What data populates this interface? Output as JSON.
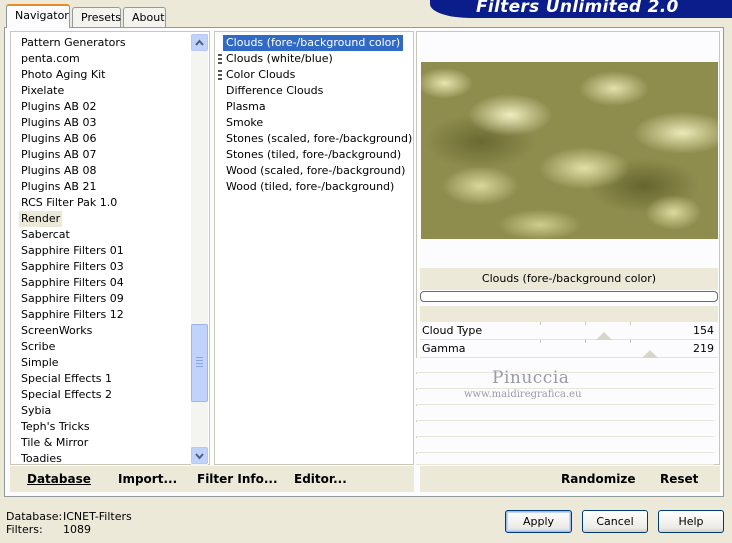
{
  "tabs": [
    {
      "label": "Navigator",
      "active": true
    },
    {
      "label": "Presets",
      "active": false
    },
    {
      "label": "About",
      "active": false
    }
  ],
  "banner_title": "Filters Unlimited 2.0",
  "categories": [
    "Pattern Generators",
    "penta.com",
    "Photo Aging Kit",
    "Pixelate",
    "Plugins AB 02",
    "Plugins AB 03",
    "Plugins AB 06",
    "Plugins AB 07",
    "Plugins AB 08",
    "Plugins AB 21",
    "RCS Filter Pak 1.0",
    "Render",
    "Sabercat",
    "Sapphire Filters 01",
    "Sapphire Filters 03",
    "Sapphire Filters 04",
    "Sapphire Filters 09",
    "Sapphire Filters 12",
    "ScreenWorks",
    "Scribe",
    "Simple",
    "Special Effects 1",
    "Special Effects 2",
    "Sybia",
    "Teph's Tricks",
    "Tile & Mirror",
    "Toadies"
  ],
  "selected_category": "Render",
  "filters": [
    "Clouds (fore-/background color)",
    "Clouds (white/blue)",
    "Color Clouds",
    "Difference Clouds",
    "Plasma",
    "Smoke",
    "Stones (scaled, fore-/background)",
    "Stones (tiled, fore-/background)",
    "Wood (scaled, fore-/background)",
    "Wood (tiled, fore-/background)"
  ],
  "selected_filter": "Clouds (fore-/background color)",
  "left_buttons": {
    "database": "Database",
    "import": "Import...",
    "filter_info": "Filter Info...",
    "editor": "Editor..."
  },
  "preview_caption": "Clouds (fore-/background color)",
  "params": [
    {
      "label": "Cloud Type",
      "value": "154",
      "fraction": 0.604
    },
    {
      "label": "Gamma",
      "value": "219",
      "fraction": 0.859
    }
  ],
  "watermark": {
    "name": "Pinuccia",
    "url": "www.maidiregrafica.eu"
  },
  "right_buttons": {
    "randomize": "Randomize",
    "reset": "Reset"
  },
  "status": {
    "database_label": "Database:",
    "database_value": "ICNET-Filters",
    "filters_label": "Filters:",
    "filters_value": "1089"
  },
  "dialog_buttons": {
    "apply": "Apply",
    "cancel": "Cancel",
    "help": "Help"
  },
  "colors": {
    "selection": "#316ac5",
    "banner": "#0a1d8a",
    "face": "#ece9d8"
  }
}
